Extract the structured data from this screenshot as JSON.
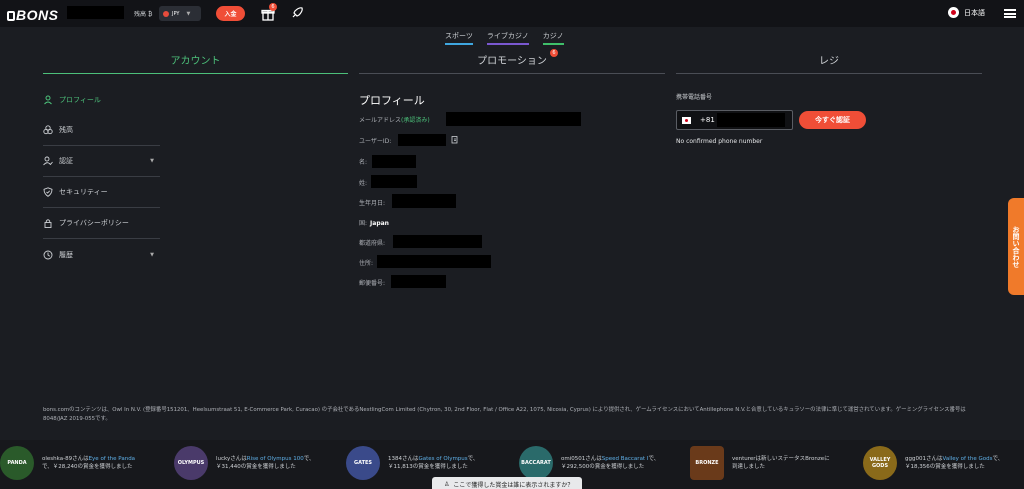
{
  "header": {
    "logo_text": "BONS",
    "balance_label": "残高",
    "balance_currency_symbol": "₿",
    "currency": "JPY",
    "deposit_label": "入金",
    "gift_badge": "6",
    "language": "日本語"
  },
  "subnav": [
    "スポーツ",
    "ライブカジノ",
    "カジノ"
  ],
  "tabs": [
    {
      "label": "アカウント",
      "active": true
    },
    {
      "label": "プロモーション",
      "badge": "6"
    },
    {
      "label": "レジ"
    }
  ],
  "sidebar": {
    "items": [
      {
        "label": "プロフィール",
        "icon": "user-icon"
      },
      {
        "label": "残高",
        "icon": "coins-icon"
      },
      {
        "label": "認証",
        "icon": "verify-user-icon",
        "expandable": true
      },
      {
        "label": "セキュリティー",
        "icon": "shield-icon"
      },
      {
        "label": "プライバシーポリシー",
        "icon": "lock-icon"
      },
      {
        "label": "履歴",
        "icon": "history-icon",
        "expandable": true
      }
    ]
  },
  "profile": {
    "title": "プロフィール",
    "email_label": "メールアドレス",
    "email_verified": "(承認済み)",
    "user_id_label": "ユーザーID:",
    "first_name_label": "名:",
    "last_name_label": "姓:",
    "birth_label": "生年月日:",
    "country_label": "国:",
    "country_value": "Japan",
    "prefecture_label": "都道府県:",
    "address_label": "住所:",
    "postal_label": "郵便番号:"
  },
  "phone": {
    "label": "携帯電話番号",
    "code": "+81",
    "verify_label": "今すぐ認証",
    "note": "No confirmed phone number"
  },
  "contact_label": "お問い合わせ",
  "legal_text": "bons.comのコンテンツは、Owl In N.V. (登録番号151201、Heelsumstraat 51, E-Commerce Park, Curacao) の子会社であるNestlingCom Limited (Chytron, 30, 2nd Floor, Flat / Office A22, 1075, Nicosia, Cyprus) により提供され、ゲームライセンスにおいてAntillephone N.V.と合意しているキュラソーの法律に準じて運営されています。ゲーミングライセンス番号は8048/JAZ 2019-055です。",
  "ticker": [
    {
      "thumb": "PANDA",
      "pre": "oleshka-89さんは",
      "game": "Eye of the Panda",
      "post": "で、￥28,240の賞金を獲得しました"
    },
    {
      "thumb": "OLYMPUS",
      "pre": "luckyさんは",
      "game": "Rise of Olympus 100",
      "post": "で、￥31,440の賞金を獲得しました"
    },
    {
      "thumb": "GATES",
      "pre": "1384さんは",
      "game": "Gates of Olympus",
      "post": "で、￥11,813の賞金を獲得しました"
    },
    {
      "thumb": "BACCARAT",
      "pre": "omi0501さんは",
      "game": "Speed Baccarat I",
      "post": "で、￥292,500の賞金を獲得しました"
    },
    {
      "thumb": "BRONZE",
      "pre": "venturerは新しいステータス",
      "game": "",
      "post": "Bronzeに到達しました"
    },
    {
      "thumb": "VALLEY GODS",
      "pre": "ggg001さんは",
      "game": "Valley of the Gods",
      "post": "で、￥18,356の賞金を獲得しました"
    }
  ],
  "popup_text": "ここで獲得した賞金は誰に表示されますか？",
  "colors": {
    "accent_green": "#4cc07a",
    "accent_red": "#f04e37",
    "contact_orange": "#f07a2a"
  }
}
